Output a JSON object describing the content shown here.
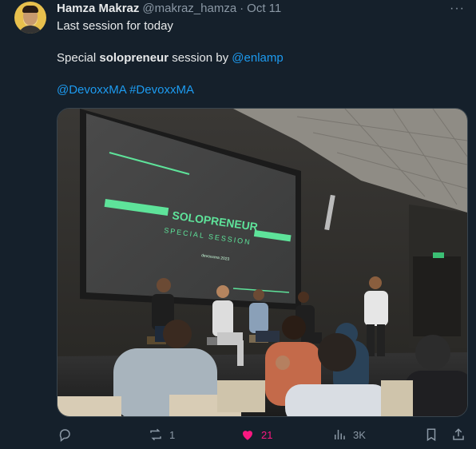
{
  "author": {
    "name": "Hamza Makraz",
    "handle": "@makraz_hamza",
    "separator": "·",
    "date": "Oct 11"
  },
  "more_label": "···",
  "text": {
    "line1": "Last session for today",
    "line2_pre": "Special ",
    "line2_bold": "solopreneur",
    "line2_mid": " session by ",
    "line2_mention": "@enlamp",
    "hashtag1": "@DevoxxMA",
    "hashtag_sep": " ",
    "hashtag2": "#DevoxxMA"
  },
  "slide": {
    "title": "SOLOPRENEUR",
    "subtitle": "SPECIAL SESSION",
    "footer": "devoxxma 2023"
  },
  "actions": {
    "reply_count": "",
    "retweet_count": "1",
    "like_count": "21",
    "views_count": "3K"
  },
  "colors": {
    "background": "#15202b",
    "link": "#1d9bf0",
    "like": "#f91880",
    "muted": "#8b98a5",
    "slide_green": "#5ee39a"
  }
}
